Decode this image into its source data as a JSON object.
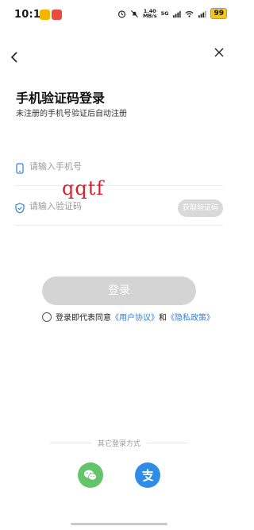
{
  "status_bar": {
    "time": "10:10",
    "speed_value": "1.40",
    "speed_unit": "MB/s",
    "network": "5G",
    "battery": "99"
  },
  "header": {
    "title": "手机验证码登录",
    "subtitle": "未注册的手机号验证后自动注册"
  },
  "form": {
    "phone_placeholder": "请输入手机号",
    "code_placeholder": "请输入验证码",
    "get_code_label": "获取验证码",
    "watermark": "qqtf"
  },
  "login_button": "登录",
  "agreement": {
    "prefix": "登录即代表同意",
    "user_agreement": "《用户协议》",
    "conjunction": "和",
    "privacy_policy": "《隐私政策》"
  },
  "other_login": {
    "label": "其它登录方式",
    "methods": [
      "wechat-icon",
      "alipay-icon"
    ]
  },
  "colors": {
    "accent_link": "#2f7fe0",
    "disabled_button": "#d4d4d4",
    "wechat": "#64c46a",
    "alipay": "#2f8ce7"
  }
}
